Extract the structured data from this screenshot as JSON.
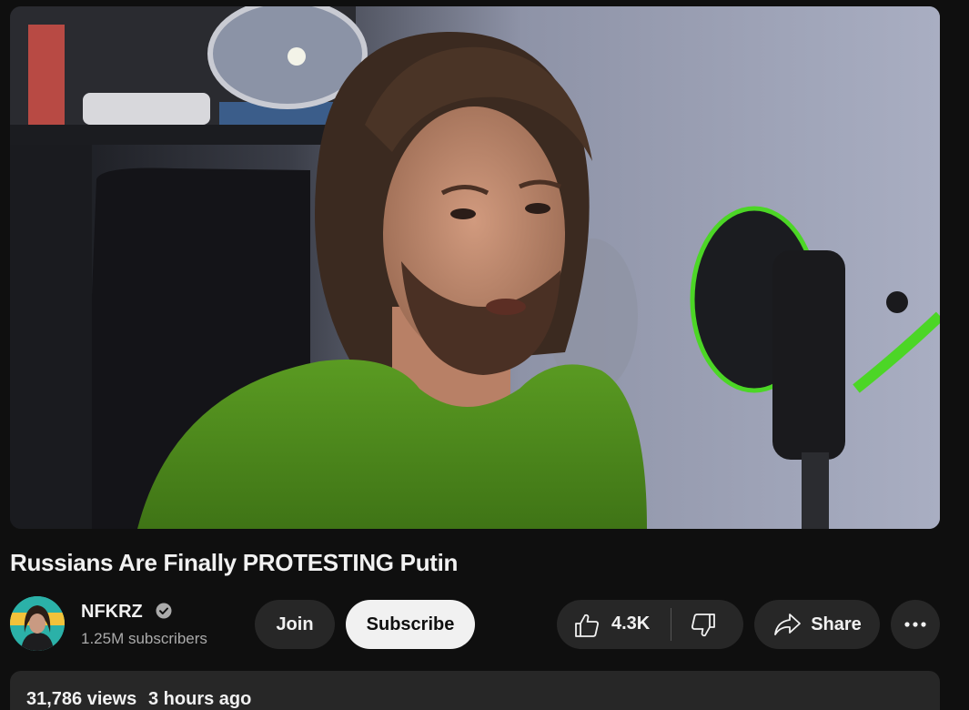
{
  "video": {
    "title": "Russians Are Finally PROTESTING Putin"
  },
  "channel": {
    "name": "NFKRZ",
    "subscribers": "1.25M subscribers",
    "verified": true
  },
  "actions": {
    "join_label": "Join",
    "subscribe_label": "Subscribe",
    "like_count": "4.3K",
    "share_label": "Share"
  },
  "description": {
    "views": "31,786 views",
    "uploaded": "3 hours ago"
  },
  "icons": {
    "like": "thumbs-up-icon",
    "dislike": "thumbs-down-icon",
    "share": "share-arrow-icon",
    "more": "more-horizontal-icon",
    "verified": "verified-check-icon"
  },
  "colors": {
    "background": "#0f0f0f",
    "pill": "#272727",
    "subscribe_bg": "#f1f1f1",
    "secondary_text": "#aaaaaa",
    "shirt_green": "#4e8a1e",
    "mic_accent": "#4cd626"
  }
}
